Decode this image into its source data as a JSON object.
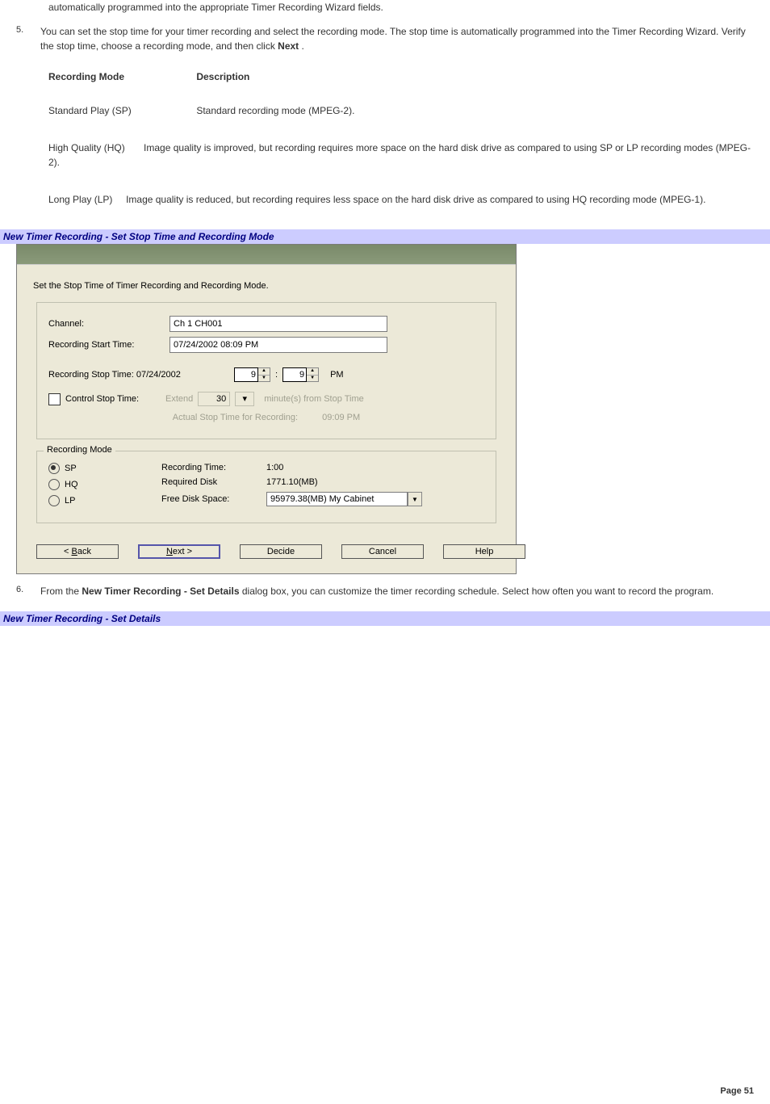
{
  "para_top": "automatically programmed into the appropriate Timer Recording Wizard fields.",
  "step5_num": "5.",
  "step5_text_a": "You can set the stop time for your timer recording and select the recording mode. The stop time is automatically programmed into the Timer Recording Wizard. Verify the stop time, choose a recording mode, and then click ",
  "step5_next": "Next",
  "step5_text_b": " .",
  "table": {
    "h1": "Recording Mode",
    "h2": "Description",
    "r1c1": "Standard Play (SP)",
    "r1c2": "Standard recording mode (MPEG-2).",
    "r2c1": "High Quality (HQ)",
    "r2c2": "Image quality is improved, but recording requires more space on the hard disk drive as compared to using SP or LP recording modes (MPEG-2).",
    "r3c1": "Long Play (LP)",
    "r3c2": "Image quality is reduced, but recording requires less space on the hard disk drive as compared to using HQ recording mode (MPEG-1)."
  },
  "caption1": "New Timer Recording - Set Stop Time and Recording Mode",
  "dialog": {
    "title": "New Timer Recording - Set Stop Time and Recording Mode",
    "close": "×",
    "intro": "Set the Stop Time of Timer Recording and Recording Mode.",
    "channel_label": "Channel:",
    "channel_value": "Ch 1 CH001",
    "start_label": "Recording Start Time:",
    "start_value": "07/24/2002 08:09 PM",
    "stop_label": "Recording Stop Time: 07/24/2002",
    "stop_hour": "9",
    "stop_min": "9",
    "stop_ampm": "PM",
    "control_label": "Control Stop Time:",
    "extend_label": "Extend",
    "extend_val": "30",
    "extend_suffix": "minute(s) from Stop Time",
    "actual_label": "Actual Stop Time for Recording:",
    "actual_value": "09:09 PM",
    "recmode_legend": "Recording Mode",
    "mode_sp": "SP",
    "mode_hq": "HQ",
    "mode_lp": "LP",
    "rec_time_label": "Recording Time:",
    "rec_time_val": "1:00",
    "req_disk_label": "Required Disk",
    "req_disk_val": "1771.10(MB)",
    "free_disk_label": "Free Disk Space:",
    "free_disk_val": "95979.38(MB) My Cabinet",
    "btn_back_u": "B",
    "btn_back": "ack",
    "btn_back_pre": "< ",
    "btn_next_u": "N",
    "btn_next": "ext >",
    "btn_decide": "Decide",
    "btn_cancel": "Cancel",
    "btn_help": "Help"
  },
  "step6_num": "6.",
  "step6_text_a": "From the ",
  "step6_bold": "New Timer Recording - Set Details",
  "step6_text_b": " dialog box, you can customize the timer recording schedule. Select how often you want to record the program.",
  "caption2": "New Timer Recording - Set Details",
  "page_footer": "Page 51"
}
